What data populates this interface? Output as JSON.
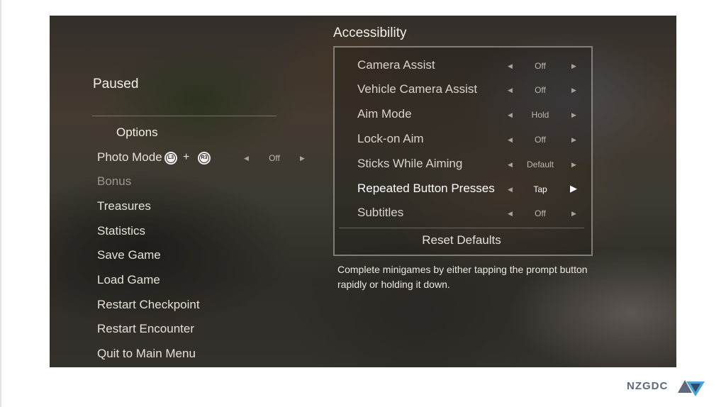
{
  "pause_menu": {
    "title": "Paused",
    "options_header": "Options",
    "photo_mode": {
      "label": "Photo Mode",
      "button_1": "L3",
      "plus": "+",
      "button_2": "R3",
      "value": "Off"
    },
    "items": [
      {
        "label": "Bonus",
        "state": "disabled"
      },
      {
        "label": "Treasures"
      },
      {
        "label": "Statistics"
      },
      {
        "label": "Save Game"
      },
      {
        "label": "Load Game"
      },
      {
        "label": "Restart Checkpoint"
      },
      {
        "label": "Restart Encounter"
      },
      {
        "label": "Quit to Main Menu"
      }
    ]
  },
  "accessibility": {
    "title": "Accessibility",
    "settings": [
      {
        "label": "Camera Assist",
        "value": "Off"
      },
      {
        "label": "Vehicle Camera Assist",
        "value": "Off"
      },
      {
        "label": "Aim Mode",
        "value": "Hold"
      },
      {
        "label": "Lock-on Aim",
        "value": "Off"
      },
      {
        "label": "Sticks While Aiming",
        "value": "Default"
      },
      {
        "label": "Repeated Button Presses",
        "value": "Tap",
        "selected": true
      },
      {
        "label": "Subtitles",
        "value": "Off"
      }
    ],
    "reset_label": "Reset Defaults",
    "description": "Complete minigames by either tapping the prompt button rapidly or holding it down."
  },
  "icons": {
    "arrow_left": "◀",
    "arrow_right": "▶"
  },
  "branding": {
    "logo_text": "NZGDC",
    "logo_color": "#5b6a7c",
    "logo_accent": "#4aa3d8"
  }
}
